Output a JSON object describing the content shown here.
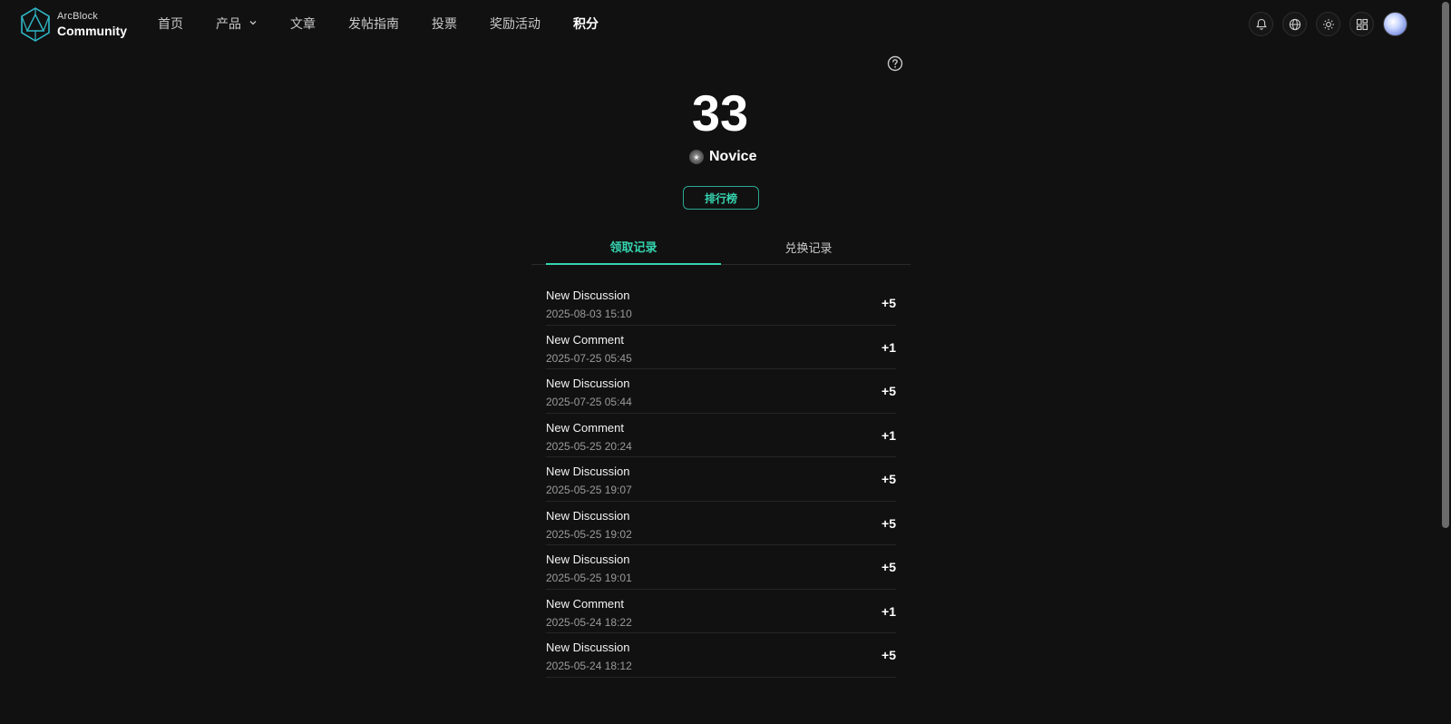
{
  "header": {
    "logo_top": "ArcBlock",
    "logo_bottom": "Community",
    "nav": [
      {
        "label": "首页"
      },
      {
        "label": "产品"
      },
      {
        "label": "文章"
      },
      {
        "label": "发帖指南"
      },
      {
        "label": "投票"
      },
      {
        "label": "奖励活动"
      },
      {
        "label": "积分"
      }
    ],
    "actions": [
      "bell-icon",
      "globe-icon",
      "sun-icon",
      "apps-icon",
      "avatar"
    ]
  },
  "summary": {
    "points": "33",
    "level": "Novice",
    "rank_button": "排行榜"
  },
  "tabs": [
    {
      "label": "领取记录",
      "active": true
    },
    {
      "label": "兑换记录",
      "active": false
    }
  ],
  "records": [
    {
      "title": "New Discussion",
      "date": "2025-08-03 15:10",
      "points": "+5"
    },
    {
      "title": "New Comment",
      "date": "2025-07-25 05:45",
      "points": "+1"
    },
    {
      "title": "New Discussion",
      "date": "2025-07-25 05:44",
      "points": "+5"
    },
    {
      "title": "New Comment",
      "date": "2025-05-25 20:24",
      "points": "+1"
    },
    {
      "title": "New Discussion",
      "date": "2025-05-25 19:07",
      "points": "+5"
    },
    {
      "title": "New Discussion",
      "date": "2025-05-25 19:02",
      "points": "+5"
    },
    {
      "title": "New Discussion",
      "date": "2025-05-25 19:01",
      "points": "+5"
    },
    {
      "title": "New Comment",
      "date": "2025-05-24 18:22",
      "points": "+1"
    },
    {
      "title": "New Discussion",
      "date": "2025-05-24 18:12",
      "points": "+5"
    }
  ],
  "colors": {
    "background": "#111111",
    "accent": "#35d4b0"
  }
}
